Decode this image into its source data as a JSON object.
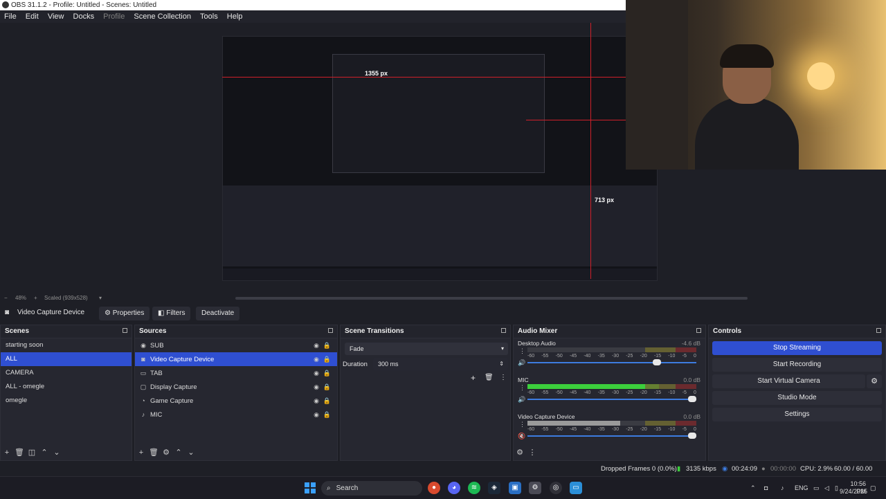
{
  "window": {
    "title": "OBS 31.1.2 - Profile: Untitled - Scenes: Untitled"
  },
  "menu": [
    "File",
    "Edit",
    "View",
    "Docks",
    "Profile",
    "Scene Collection",
    "Tools",
    "Help"
  ],
  "preview": {
    "zoom": "48%",
    "scale_mode": "Scaled (939x528)",
    "measure_width": "1355 px",
    "measure_height": "713 px"
  },
  "source_toolbar": {
    "source_name": "Video Capture Device",
    "properties": "Properties",
    "filters": "Filters",
    "deactivate": "Deactivate"
  },
  "scenes": {
    "title": "Scenes",
    "items": [
      "starting soon",
      "ALL",
      "CAMERA",
      "ALL - omegle",
      "omegle"
    ],
    "selected": "ALL"
  },
  "sources": {
    "title": "Sources",
    "items": [
      {
        "name": "SUB",
        "icon": "browser-icon"
      },
      {
        "name": "Video Capture Device",
        "icon": "camera-icon"
      },
      {
        "name": "TAB",
        "icon": "window-icon"
      },
      {
        "name": "Display Capture",
        "icon": "monitor-icon"
      },
      {
        "name": "Game Capture",
        "icon": "gamepad-icon"
      },
      {
        "name": "MIC",
        "icon": "microphone-icon"
      }
    ],
    "selected": "Video Capture Device"
  },
  "transitions": {
    "title": "Scene Transitions",
    "type": "Fade",
    "duration_label": "Duration",
    "duration_value": "300 ms"
  },
  "mixer": {
    "title": "Audio Mixer",
    "ticks": [
      "-60",
      "-55",
      "-50",
      "-45",
      "-40",
      "-35",
      "-30",
      "-25",
      "-20",
      "-15",
      "-10",
      "-5",
      "0"
    ],
    "channels": [
      {
        "name": "Desktop Audio",
        "db": "-4.6 dB",
        "level": 0.0,
        "volume": 0.78,
        "color": "#3c8c3c"
      },
      {
        "name": "MIC",
        "db": "0.0 dB",
        "level": 0.78,
        "volume": 1.0,
        "color": "#3ccf3c"
      },
      {
        "name": "Video Capture Device",
        "db": "0.0 dB",
        "level": 0.55,
        "volume": 1.0,
        "color": "#9a9a9a"
      }
    ]
  },
  "controls": {
    "title": "Controls",
    "stop_streaming": "Stop Streaming",
    "start_recording": "Start Recording",
    "start_virtual_camera": "Start Virtual Camera",
    "studio_mode": "Studio Mode",
    "settings": "Settings"
  },
  "status": {
    "dropped_frames": "Dropped Frames 0 (0.0%)",
    "bitrate": "3135 kbps",
    "stream_time": "00:24:09",
    "rec_time": "00:00:00",
    "cpu": "CPU: 2.9%",
    "fps": "60.00 / 60.00 FPS"
  },
  "taskbar": {
    "search_placeholder": "Search",
    "lang": "ENG",
    "time": "10:56 PM",
    "date": "9/24/2025"
  },
  "colors": {
    "accent": "#2f4fd1",
    "background": "#1e1f26",
    "dock": "#262730",
    "measure": "#d0202a"
  }
}
